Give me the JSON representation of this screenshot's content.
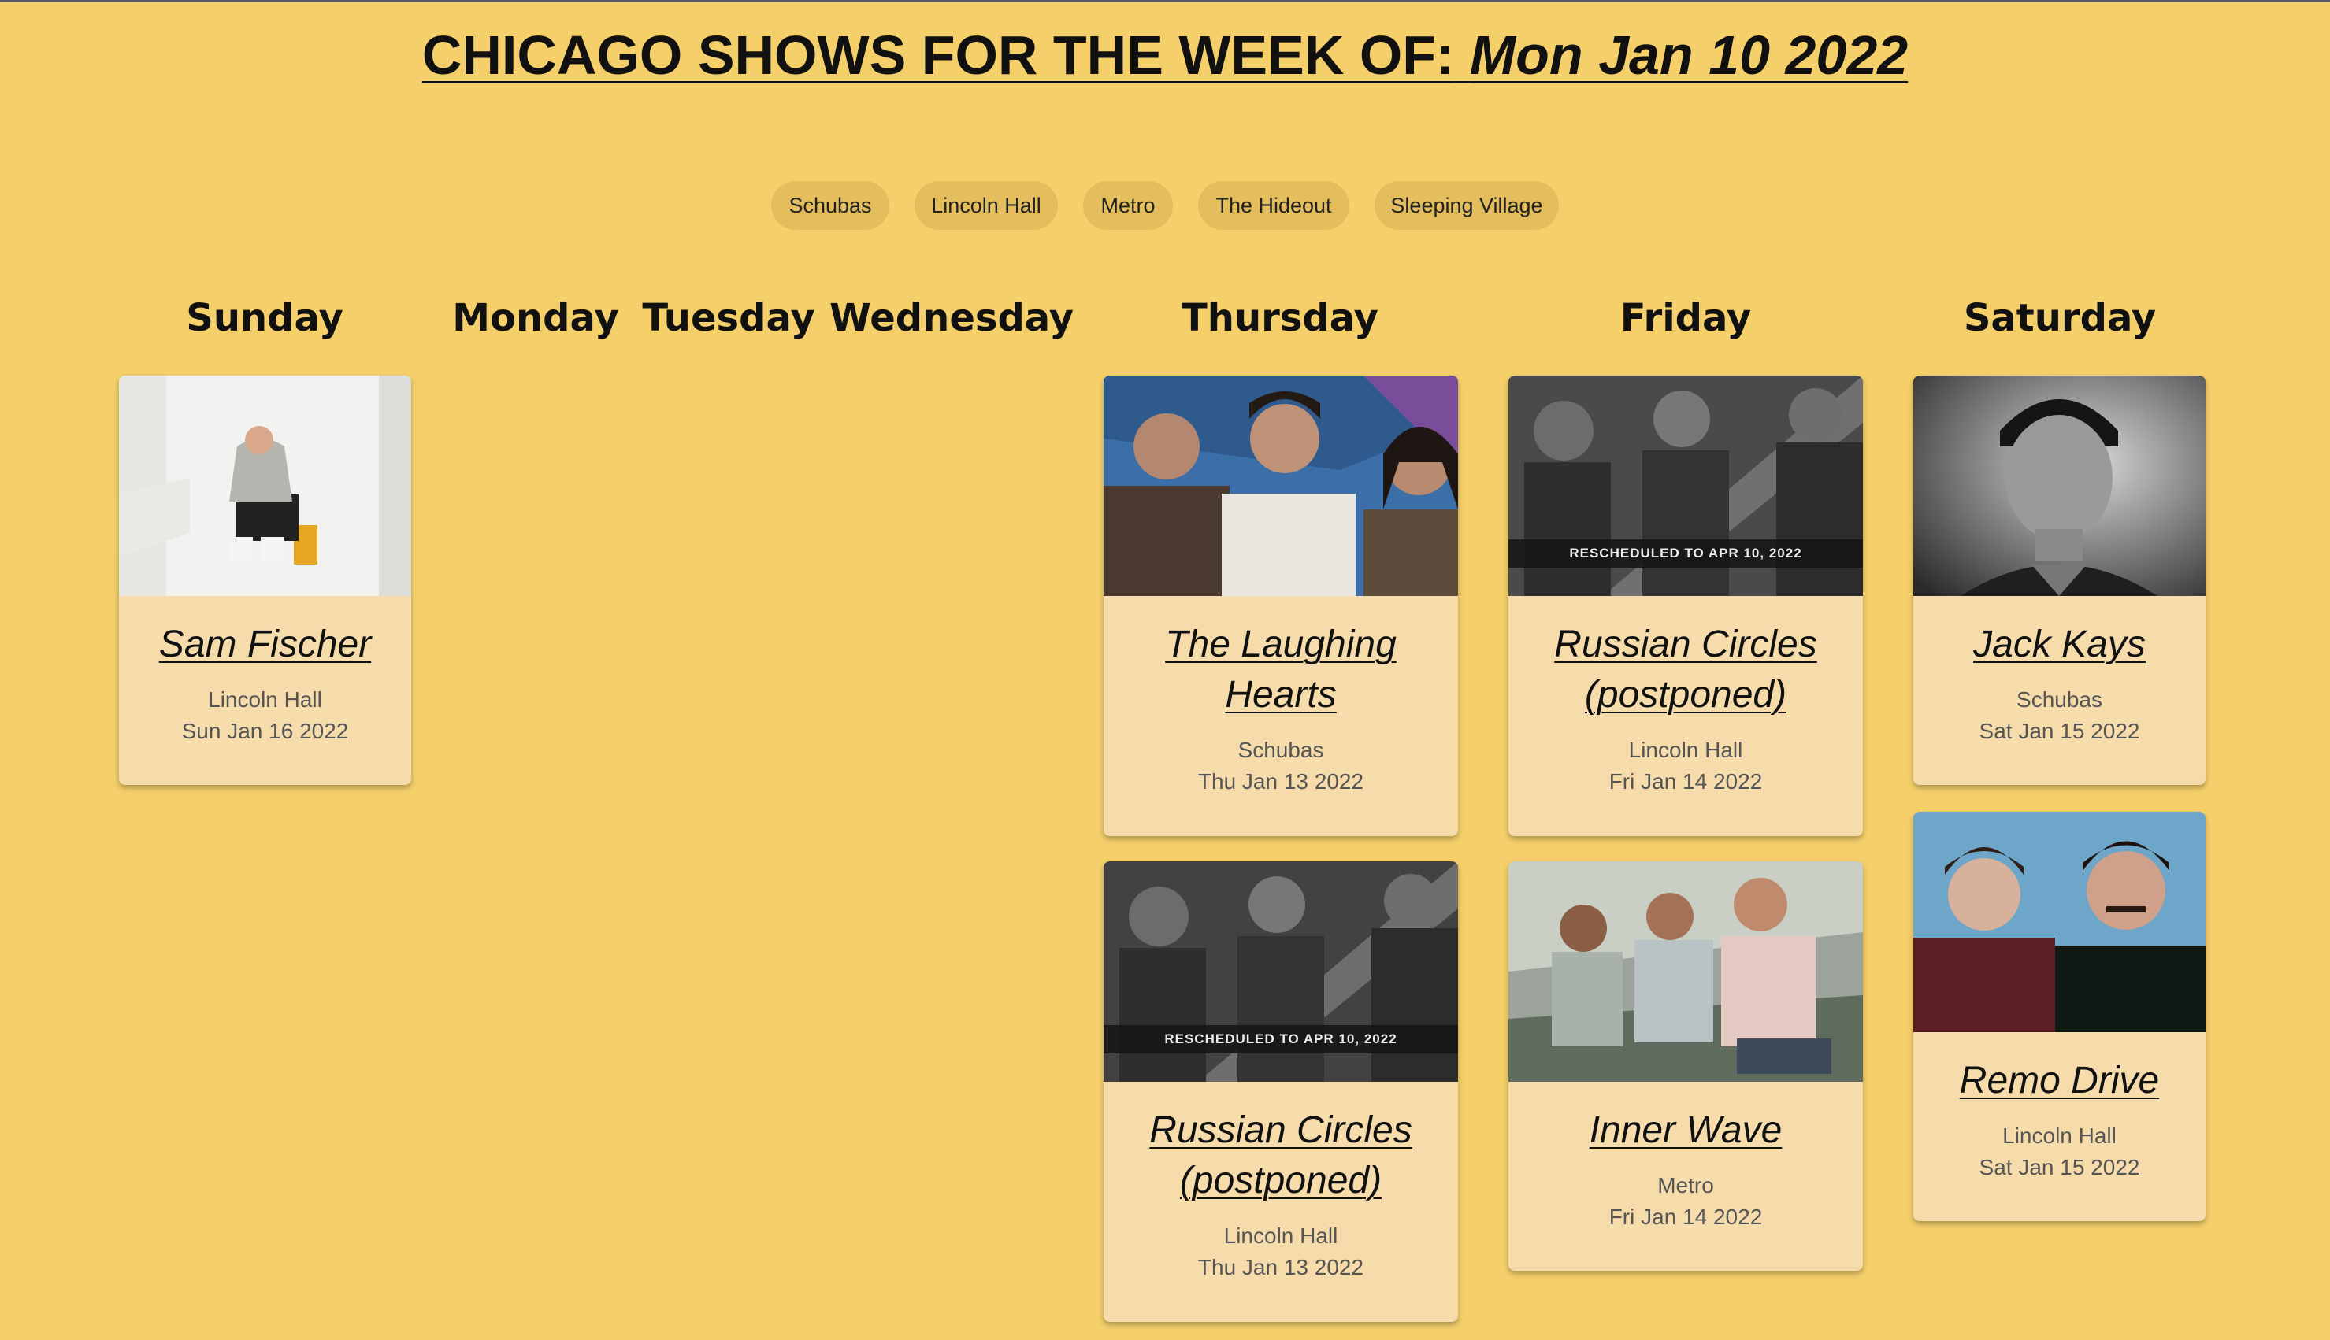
{
  "title": {
    "prefix": "CHICAGO SHOWS FOR THE WEEK OF:",
    "date": "Mon Jan 10 2022"
  },
  "filters": [
    "Schubas",
    "Lincoln Hall",
    "Metro",
    "The Hideout",
    "Sleeping Village"
  ],
  "days": [
    "Sunday",
    "Monday",
    "Tuesday",
    "Wednesday",
    "Thursday",
    "Friday",
    "Saturday"
  ],
  "shows": {
    "sam_fischer": {
      "name": "Sam Fischer",
      "venue": "Lincoln Hall",
      "date": "Sun Jan 16 2022"
    },
    "laughing_hearts": {
      "name_line1": "The Laughing",
      "name_line2": "Hearts",
      "venue": "Schubas",
      "date": "Thu Jan 13 2022"
    },
    "russian_circles_thu": {
      "name_line1": "Russian Circles",
      "name_line2": "(postponed)",
      "venue": "Lincoln Hall",
      "date": "Thu Jan 13 2022",
      "banner": "RESCHEDULED TO APR 10, 2022"
    },
    "russian_circles_fri": {
      "name_line1": "Russian Circles",
      "name_line2": "(postponed)",
      "venue": "Lincoln Hall",
      "date": "Fri Jan 14 2022",
      "banner": "RESCHEDULED TO APR 10, 2022"
    },
    "inner_wave": {
      "name": "Inner Wave",
      "venue": "Metro",
      "date": "Fri Jan 14 2022"
    },
    "jack_kays": {
      "name": "Jack Kays",
      "venue": "Schubas",
      "date": "Sat Jan 15 2022"
    },
    "remo_drive": {
      "name": "Remo Drive",
      "venue": "Lincoln Hall",
      "date": "Sat Jan 15 2022"
    }
  }
}
